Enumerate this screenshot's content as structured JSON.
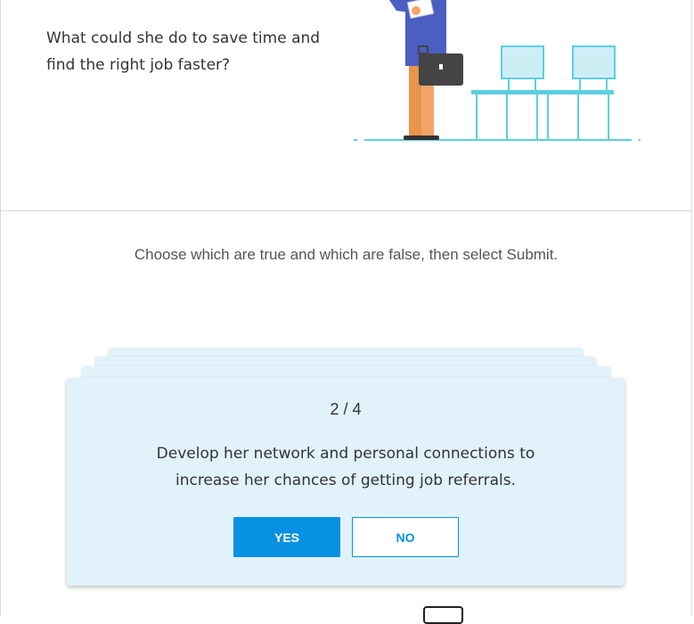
{
  "question": {
    "line1": "What could she do to save time and",
    "line2": "find the right job faster?"
  },
  "instruction": "Choose which are true and which are false, then select Submit.",
  "card": {
    "counter": "2 / 4",
    "statement_line1": "Develop her network and personal connections to",
    "statement_line2": "increase her chances of getting job referrals.",
    "yes_label": "YES",
    "no_label": "NO"
  },
  "colors": {
    "accent": "#0891e2",
    "card_background": "#e1f2fb",
    "chair": "#5ccfe0",
    "suit": "#4a5fc1",
    "briefcase": "#444444"
  },
  "illustration": {
    "icon": "job-seeker-waiting-illustration"
  }
}
